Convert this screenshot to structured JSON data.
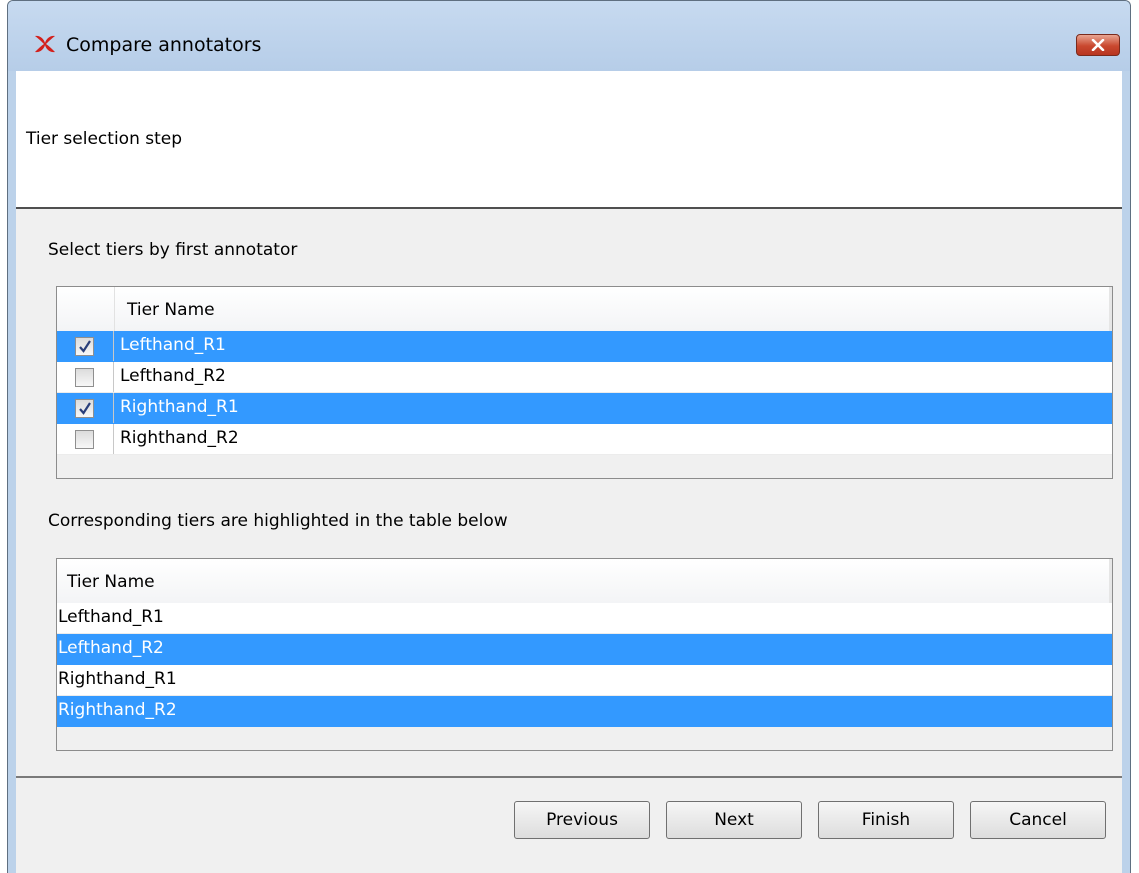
{
  "window": {
    "title": "Compare annotators"
  },
  "header": {
    "step_title": "Tier selection step"
  },
  "first_annotator": {
    "label": "Select tiers by first annotator",
    "column_header": "Tier Name",
    "rows": [
      {
        "name": "Lefthand_R1",
        "checked": true,
        "selected": true
      },
      {
        "name": "Lefthand_R2",
        "checked": false,
        "selected": false
      },
      {
        "name": "Righthand_R1",
        "checked": true,
        "selected": true
      },
      {
        "name": "Righthand_R2",
        "checked": false,
        "selected": false
      }
    ]
  },
  "corresponding": {
    "label": "Corresponding tiers are highlighted in the table below",
    "column_header": "Tier Name",
    "rows": [
      {
        "name": "Lefthand_R1",
        "selected": false
      },
      {
        "name": "Lefthand_R2",
        "selected": true
      },
      {
        "name": "Righthand_R1",
        "selected": false
      },
      {
        "name": "Righthand_R2",
        "selected": true
      }
    ]
  },
  "buttons": {
    "previous": "Previous",
    "next": "Next",
    "finish": "Finish",
    "cancel": "Cancel"
  },
  "colors": {
    "selection": "#3399ff",
    "titlebar": "#bcd2ea",
    "close_button": "#c9482f"
  }
}
